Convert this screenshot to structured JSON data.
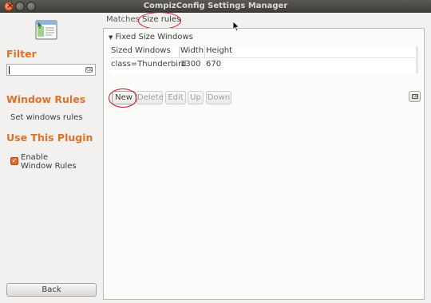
{
  "window": {
    "title": "CompizConfig Settings Manager"
  },
  "sidebar": {
    "icon": "window-rules-plugin-icon",
    "filter_heading": "Filter",
    "filter_value": "",
    "window_rules_heading": "Window Rules",
    "set_rules_label": "Set windows rules",
    "use_plugin_heading": "Use This Plugin",
    "enable_label": "Enable\nWindow Rules",
    "enable_checked": true,
    "back_label": "Back"
  },
  "tabs": [
    {
      "label": "Matches",
      "active": false
    },
    {
      "label": "Size rules",
      "active": true
    }
  ],
  "section": {
    "expander_label": "Fixed Size Windows",
    "columns": [
      "Sized Windows",
      "Width",
      "Height"
    ],
    "rows": [
      {
        "window": "class=Thunderbird",
        "width": "1300",
        "height": "670"
      }
    ],
    "buttons": {
      "new": "New",
      "delete": "Delete",
      "edit": "Edit",
      "up": "Up",
      "down": "Down"
    }
  },
  "colors": {
    "accent": "#e0702a",
    "annotation": "#c8102e",
    "titlebar": "#3d3c38"
  }
}
